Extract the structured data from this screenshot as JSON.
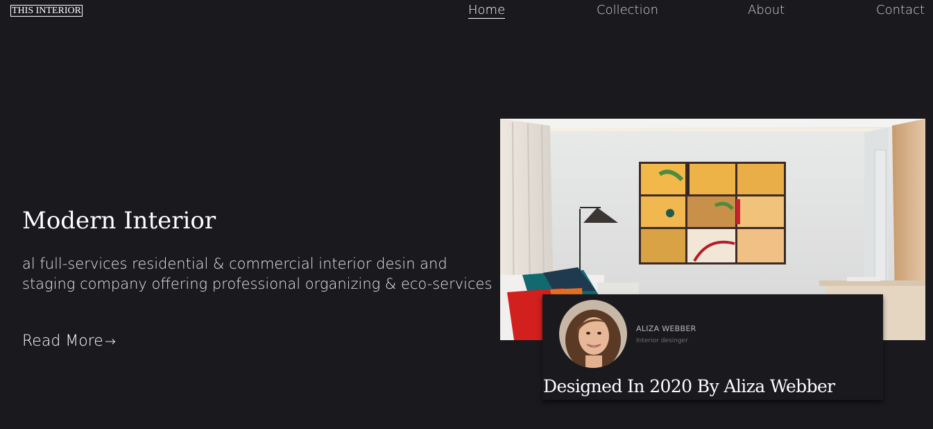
{
  "header": {
    "logo": "THIS INTERIOR",
    "nav": [
      "Home",
      "Collection",
      "About",
      "Contact"
    ],
    "active_nav": "Home"
  },
  "hero": {
    "title": "Modern Interior",
    "description": "al full-services residential & commercial interior desin and staging company offering professional organizing & eco-services",
    "read_more": "Read More",
    "read_more_arrow": "→"
  },
  "card": {
    "designer_name": "ALIZA WEBBER",
    "designer_role": "Interior desinger",
    "caption": "Designed In 2020 By Aliza Webber"
  },
  "colors": {
    "background": "#1a191d",
    "text": "#ffffff",
    "muted_text": "#b9b9b9"
  }
}
